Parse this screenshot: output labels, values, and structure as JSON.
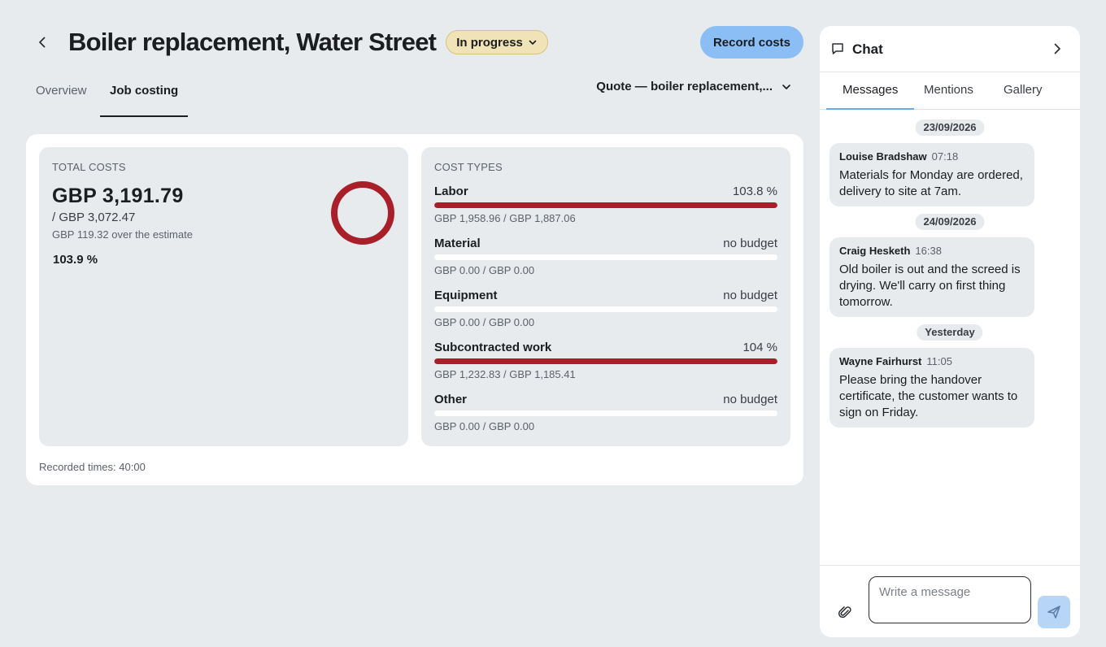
{
  "header": {
    "title": "Boiler replacement, Water Street",
    "status_label": "In progress",
    "record_costs_label": "Record costs"
  },
  "tabs": [
    {
      "label": "Overview",
      "active": false
    },
    {
      "label": "Job costing",
      "active": true
    }
  ],
  "quote_select": {
    "label": "Quote — boiler replacement,..."
  },
  "total_costs": {
    "label": "TOTAL COSTS",
    "amount": "GBP 3,191.79",
    "budget": "/ GBP 3,072.47",
    "over_estimate": "GBP 119.32 over the estimate",
    "percent_label": "103.9 %",
    "percent_value": 103.9
  },
  "cost_types": {
    "label": "COST TYPES",
    "items": [
      {
        "name": "Labor",
        "percent_label": "103.8 %",
        "fill_fraction": 1.0,
        "amounts": "GBP 1,958.96 / GBP 1,887.06"
      },
      {
        "name": "Material",
        "percent_label": "no budget",
        "fill_fraction": 0.0,
        "amounts": "GBP 0.00 / GBP 0.00"
      },
      {
        "name": "Equipment",
        "percent_label": "no budget",
        "fill_fraction": 0.0,
        "amounts": "GBP 0.00 / GBP 0.00"
      },
      {
        "name": "Subcontracted work",
        "percent_label": "104 %",
        "fill_fraction": 1.0,
        "amounts": "GBP 1,232.83 / GBP 1,185.41"
      },
      {
        "name": "Other",
        "percent_label": "no budget",
        "fill_fraction": 0.0,
        "amounts": "GBP 0.00 / GBP 0.00"
      }
    ]
  },
  "recorded_times": "Recorded times: 40:00",
  "chat": {
    "title": "Chat",
    "tabs": [
      {
        "label": "Messages",
        "active": true
      },
      {
        "label": "Mentions",
        "active": false
      },
      {
        "label": "Gallery",
        "active": false
      }
    ],
    "groups": [
      {
        "date": "23/09/2026",
        "messages": [
          {
            "author": "Louise Bradshaw",
            "time": "07:18",
            "text": "Materials for Monday are ordered, delivery to site at 7am."
          }
        ]
      },
      {
        "date": "24/09/2026",
        "messages": [
          {
            "author": "Craig Hesketh",
            "time": "16:38",
            "text": "Old boiler is out and the screed is drying. We'll carry on first thing tomorrow."
          }
        ]
      },
      {
        "date": "Yesterday",
        "messages": [
          {
            "author": "Wayne Fairhurst",
            "time": "11:05",
            "text": "Please bring the handover certificate, the customer wants to sign on Friday."
          }
        ]
      }
    ],
    "input_placeholder": "Write a message"
  },
  "colors": {
    "accent_blue": "#8bbef5",
    "over_budget_red": "#a81f2a",
    "status_pill_bg": "#f0e3b8"
  },
  "icons": {
    "back": "chevron-left-icon",
    "status_dropdown": "chevron-down-icon",
    "quote_dropdown": "chevron-down-icon",
    "chat": "chat-bubble-icon",
    "chat_close": "chevron-right-icon",
    "attach": "paperclip-icon",
    "send": "send-icon"
  }
}
